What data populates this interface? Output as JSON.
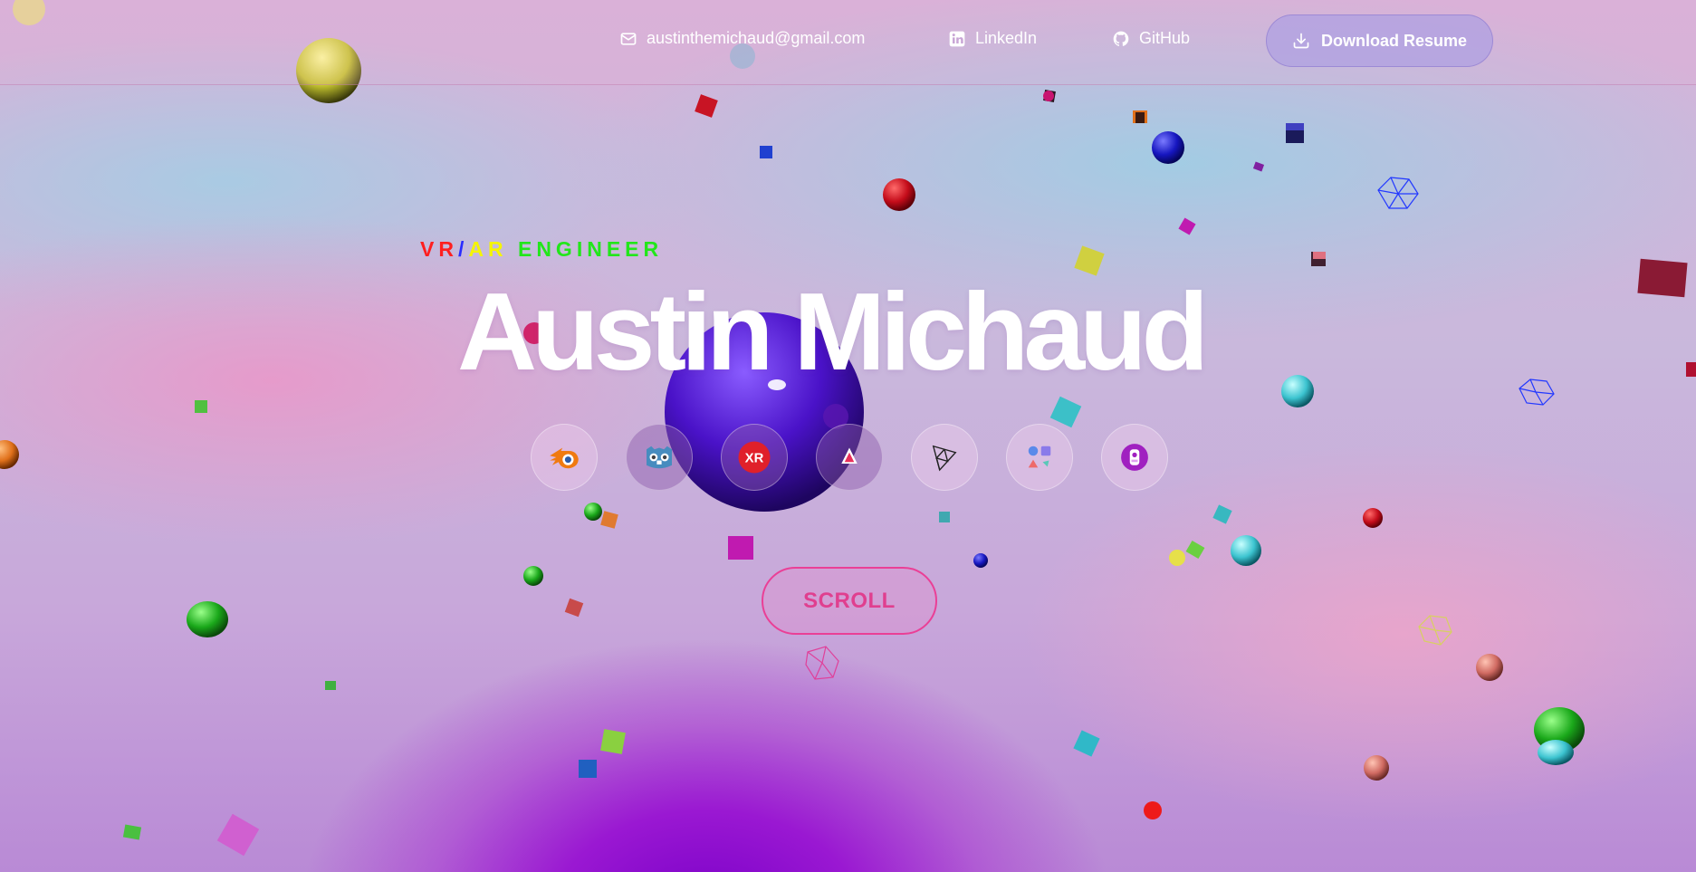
{
  "header": {
    "email": {
      "label": "austinthemichaud@gmail.com",
      "icon": "mail-icon"
    },
    "linkedin": {
      "label": "LinkedIn",
      "icon": "linkedin-icon"
    },
    "github": {
      "label": "GitHub",
      "icon": "github-icon"
    },
    "resume": {
      "label": "Download Resume",
      "icon": "download-icon"
    }
  },
  "hero": {
    "subtitle_parts": [
      {
        "text": "V",
        "color": "#ff1f1f"
      },
      {
        "text": "R",
        "color": "#ff1f1f"
      },
      {
        "text": "/",
        "color": "#2a2cff"
      },
      {
        "text": "AR",
        "color": "#f5f500"
      },
      {
        "text": " ",
        "color": "#ffffff"
      },
      {
        "text": "ENGINEER",
        "color": "#22e61a"
      }
    ],
    "name": "Austin Michaud",
    "scroll_label": "SCROLL"
  },
  "tools": [
    {
      "icon": "blender-icon"
    },
    {
      "icon": "godot-icon"
    },
    {
      "icon": "openxr-icon",
      "text": "XR"
    },
    {
      "icon": "affinity-designer-icon"
    },
    {
      "icon": "threejs-icon"
    },
    {
      "icon": "shapes-icon"
    },
    {
      "icon": "discord-bot-icon"
    }
  ],
  "colors": {
    "accent_pink": "#ea3f96",
    "title": "#ffffff",
    "button_bg": "#afa0e1"
  }
}
